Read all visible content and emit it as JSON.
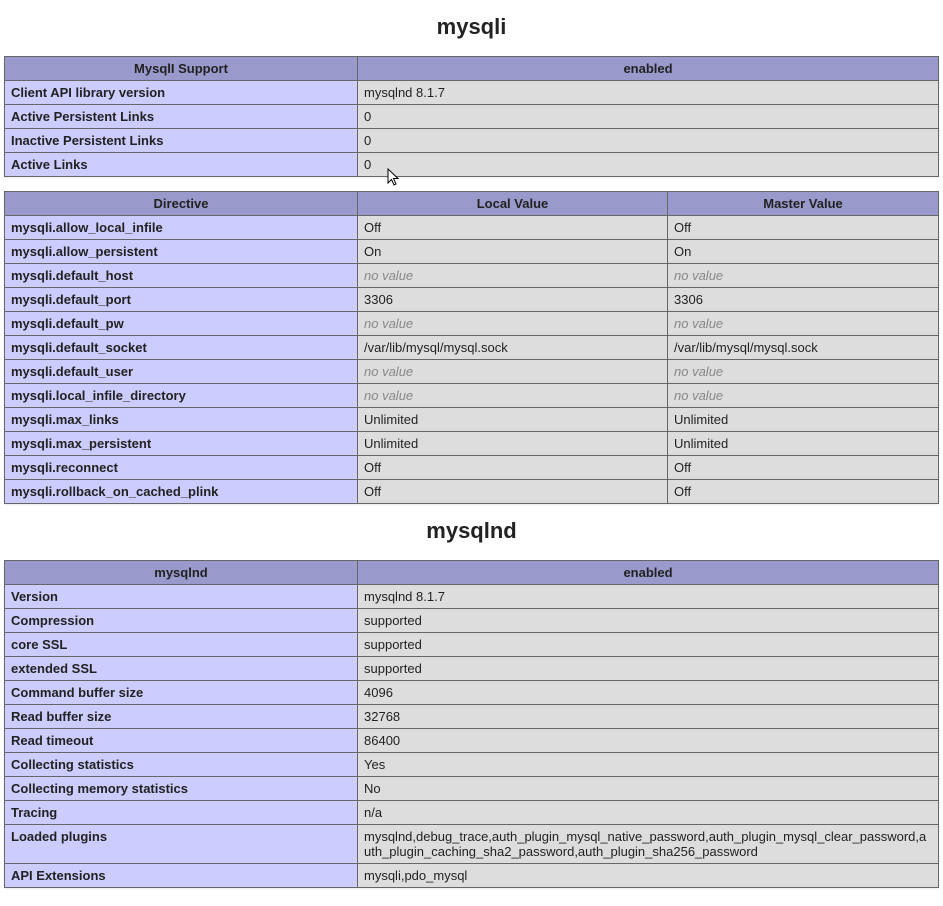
{
  "no_value_text": "no value",
  "mysqli": {
    "title": "mysqli",
    "support_header": {
      "left": "MysqlI Support",
      "right": "enabled"
    },
    "support_rows": [
      {
        "k": "Client API library version",
        "v": "mysqlnd 8.1.7"
      },
      {
        "k": "Active Persistent Links",
        "v": "0"
      },
      {
        "k": "Inactive Persistent Links",
        "v": "0"
      },
      {
        "k": "Active Links",
        "v": "0"
      }
    ],
    "directive_header": {
      "directive": "Directive",
      "local": "Local Value",
      "master": "Master Value"
    },
    "directive_rows": [
      {
        "d": "mysqli.allow_local_infile",
        "l": "Off",
        "m": "Off"
      },
      {
        "d": "mysqli.allow_persistent",
        "l": "On",
        "m": "On"
      },
      {
        "d": "mysqli.default_host",
        "l": null,
        "m": null
      },
      {
        "d": "mysqli.default_port",
        "l": "3306",
        "m": "3306"
      },
      {
        "d": "mysqli.default_pw",
        "l": null,
        "m": null
      },
      {
        "d": "mysqli.default_socket",
        "l": "/var/lib/mysql/mysql.sock",
        "m": "/var/lib/mysql/mysql.sock"
      },
      {
        "d": "mysqli.default_user",
        "l": null,
        "m": null
      },
      {
        "d": "mysqli.local_infile_directory",
        "l": null,
        "m": null
      },
      {
        "d": "mysqli.max_links",
        "l": "Unlimited",
        "m": "Unlimited"
      },
      {
        "d": "mysqli.max_persistent",
        "l": "Unlimited",
        "m": "Unlimited"
      },
      {
        "d": "mysqli.reconnect",
        "l": "Off",
        "m": "Off"
      },
      {
        "d": "mysqli.rollback_on_cached_plink",
        "l": "Off",
        "m": "Off"
      }
    ]
  },
  "mysqlnd": {
    "title": "mysqlnd",
    "support_header": {
      "left": "mysqlnd",
      "right": "enabled"
    },
    "rows": [
      {
        "k": "Version",
        "v": "mysqlnd 8.1.7"
      },
      {
        "k": "Compression",
        "v": "supported"
      },
      {
        "k": "core SSL",
        "v": "supported"
      },
      {
        "k": "extended SSL",
        "v": "supported"
      },
      {
        "k": "Command buffer size",
        "v": "4096"
      },
      {
        "k": "Read buffer size",
        "v": "32768"
      },
      {
        "k": "Read timeout",
        "v": "86400"
      },
      {
        "k": "Collecting statistics",
        "v": "Yes"
      },
      {
        "k": "Collecting memory statistics",
        "v": "No"
      },
      {
        "k": "Tracing",
        "v": "n/a"
      },
      {
        "k": "Loaded plugins",
        "v": "mysqlnd,debug_trace,auth_plugin_mysql_native_password,auth_plugin_mysql_clear_password,auth_plugin_caching_sha2_password,auth_plugin_sha256_password"
      },
      {
        "k": "API Extensions",
        "v": "mysqli,pdo_mysql"
      }
    ]
  }
}
